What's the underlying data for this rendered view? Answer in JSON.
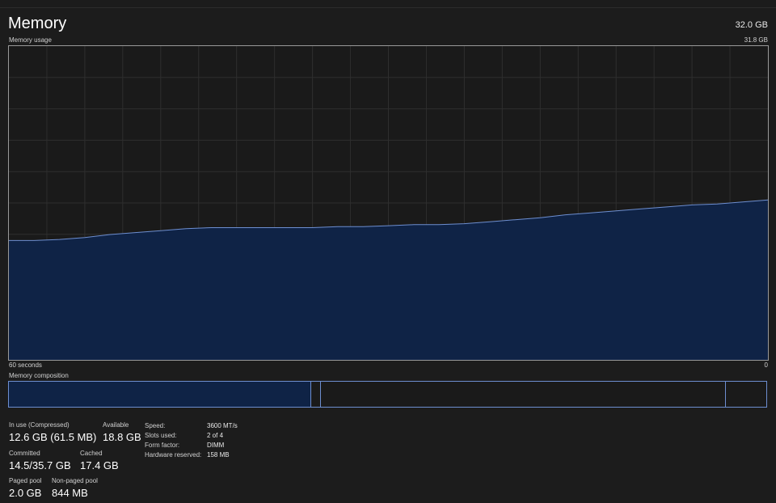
{
  "header": {
    "title": "Memory",
    "total": "32.0 GB",
    "subtitle": "Memory usage",
    "max_label": "31.8 GB"
  },
  "graph": {
    "x_left_label": "60 seconds",
    "x_right_label": "0"
  },
  "chart_data": {
    "type": "area",
    "title": "Memory usage",
    "x": [
      60,
      58,
      56,
      54,
      52,
      50,
      48,
      46,
      44,
      42,
      40,
      38,
      36,
      34,
      32,
      30,
      28,
      26,
      24,
      22,
      20,
      18,
      16,
      14,
      12,
      10,
      8,
      6,
      4,
      2,
      0
    ],
    "y": [
      12.1,
      12.1,
      12.2,
      12.4,
      12.7,
      12.9,
      13.1,
      13.3,
      13.4,
      13.4,
      13.4,
      13.4,
      13.4,
      13.5,
      13.5,
      13.6,
      13.7,
      13.7,
      13.8,
      14.0,
      14.2,
      14.4,
      14.7,
      14.9,
      15.1,
      15.3,
      15.5,
      15.7,
      15.8,
      16.0,
      16.2
    ],
    "xlim": [
      60,
      0
    ],
    "ylim": [
      0,
      31.8
    ],
    "xlabel": "60 seconds",
    "grid": true,
    "colors": {
      "fill": "#0f2346",
      "line": "#6d8ed0"
    }
  },
  "composition": {
    "label": "Memory composition"
  },
  "stats": {
    "in_use": {
      "label": "In use (Compressed)",
      "value": "12.6 GB (61.5 MB)"
    },
    "available": {
      "label": "Available",
      "value": "18.8 GB"
    },
    "committed": {
      "label": "Committed",
      "value": "14.5/35.7 GB"
    },
    "cached": {
      "label": "Cached",
      "value": "17.4 GB"
    },
    "paged_pool": {
      "label": "Paged pool",
      "value": "2.0 GB"
    },
    "non_paged_pool": {
      "label": "Non-paged pool",
      "value": "844 MB"
    }
  },
  "details": {
    "speed": {
      "label": "Speed:",
      "value": "3600 MT/s"
    },
    "slots": {
      "label": "Slots used:",
      "value": "2 of 4"
    },
    "form_factor": {
      "label": "Form factor:",
      "value": "DIMM"
    },
    "hw_reserved": {
      "label": "Hardware reserved:",
      "value": "158 MB"
    }
  }
}
